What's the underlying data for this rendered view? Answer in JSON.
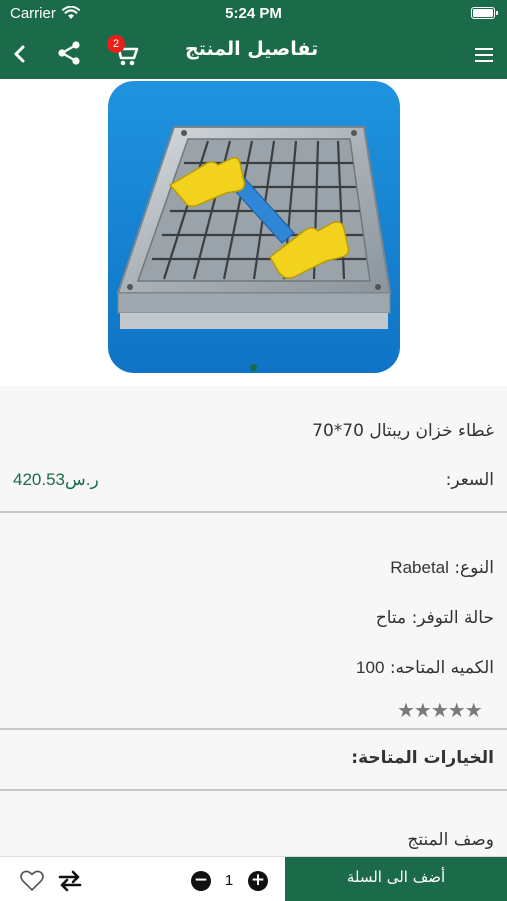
{
  "status_bar": {
    "carrier": "Carrier",
    "time": "5:24 PM"
  },
  "nav": {
    "title": "تفاصيل المنتج",
    "cart_count": "2",
    "icons": [
      "back-icon",
      "share-icon",
      "cart-icon",
      "menu-icon"
    ]
  },
  "product": {
    "name": "غطاء خزان ريبتال 70*70",
    "price_label": "السعر:",
    "price_value": "ر.س420.53",
    "type_label": "النوع:",
    "type_value": "Rabetal",
    "availability_label": "حالة التوفر:",
    "availability_value": "متاح",
    "quantity_label": "الكميه المتاحه:",
    "quantity_value": "100",
    "stars": "★★★★★",
    "rating_out_of_5": 0,
    "image_page_current": 1,
    "image_page_count": 1
  },
  "sections": {
    "options_title": "الخيارات المتاحة:",
    "description_title": "وصف المنتج"
  },
  "bottom_bar": {
    "add_to_cart_label": "أضف الى السلة",
    "quantity": "1",
    "minus": "−",
    "plus": "+"
  },
  "colors": {
    "primary": "#1b6b4a",
    "badge": "#e8201a",
    "stars": "#7a7a7a"
  }
}
